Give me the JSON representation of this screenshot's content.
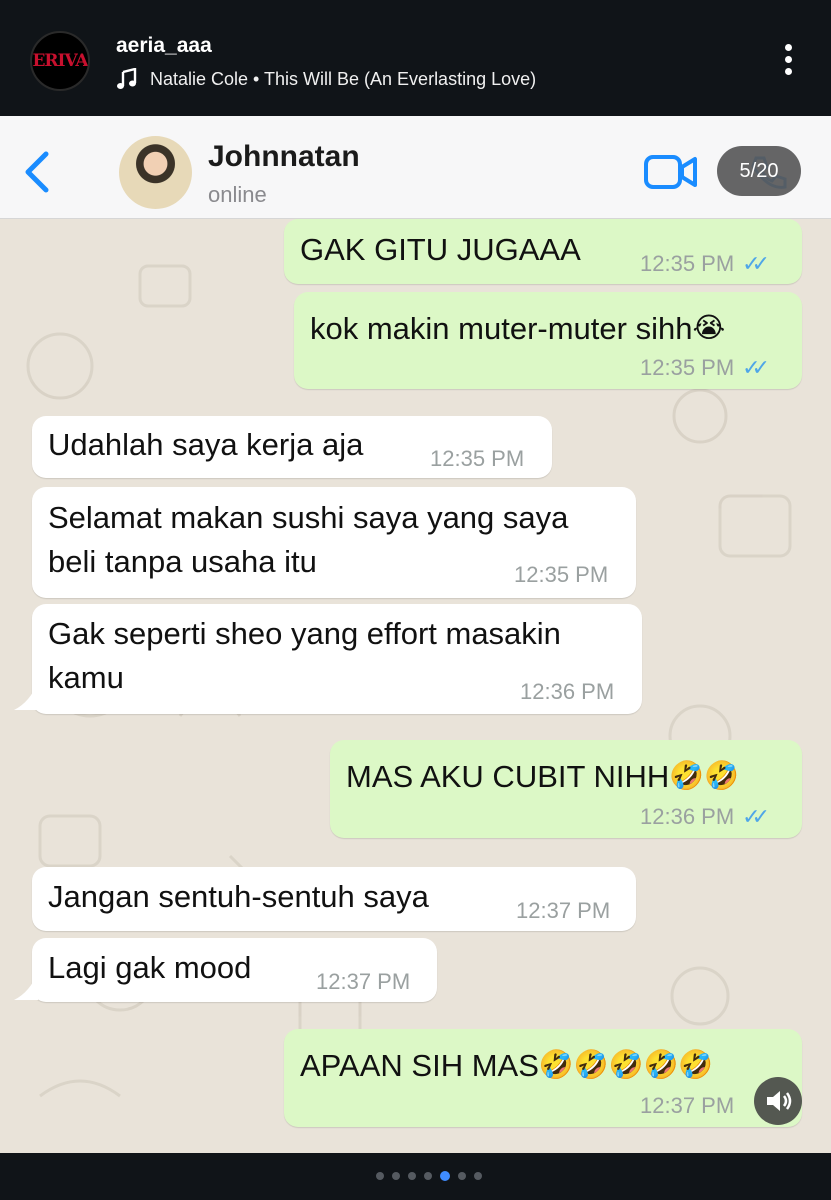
{
  "story": {
    "username": "aeria_aaa",
    "avatar_text": "ERIVA",
    "music": "Natalie Cole • This Will Be (An Everlasting Love)",
    "counter": "5/20",
    "active_page": 5
  },
  "chat": {
    "contact_name": "Johnnatan",
    "contact_status": "online",
    "messages": [
      {
        "dir": "out",
        "text": "GAK GITU JUGAAA",
        "time": "12:35 PM",
        "ticks": "✓✓"
      },
      {
        "dir": "out",
        "text": "kok makin muter-muter sihh",
        "emoji": "😭",
        "time": "12:35 PM",
        "ticks": "✓✓"
      },
      {
        "dir": "in",
        "text": "Udahlah saya kerja aja",
        "time": "12:35 PM"
      },
      {
        "dir": "in",
        "line1": "Selamat makan sushi saya yang saya",
        "line2": "beli tanpa usaha itu",
        "time": "12:35 PM"
      },
      {
        "dir": "in",
        "line1": "Gak seperti sheo yang effort masakin",
        "line2": "kamu",
        "time": "12:36 PM"
      },
      {
        "dir": "out",
        "text": "MAS AKU CUBIT NIHH",
        "emoji": "🤣🤣",
        "time": "12:36 PM",
        "ticks": "✓✓"
      },
      {
        "dir": "in",
        "text": "Jangan sentuh-sentuh saya",
        "time": "12:37 PM"
      },
      {
        "dir": "in",
        "text": "Lagi gak mood",
        "time": "12:37 PM"
      },
      {
        "dir": "out",
        "text": "APAAN SIH MAS",
        "emoji": "🤣🤣🤣🤣🤣",
        "time": "12:37 PM"
      }
    ]
  },
  "colors": {
    "outgoing": "#dcf8c6",
    "incoming": "#ffffff",
    "accent": "#1a8cff",
    "ticks": "#4fa6e8"
  },
  "icons": [
    "music-note-icon",
    "more-vertical-icon",
    "back-chevron-icon",
    "video-call-icon",
    "phone-icon",
    "speaker-icon"
  ]
}
